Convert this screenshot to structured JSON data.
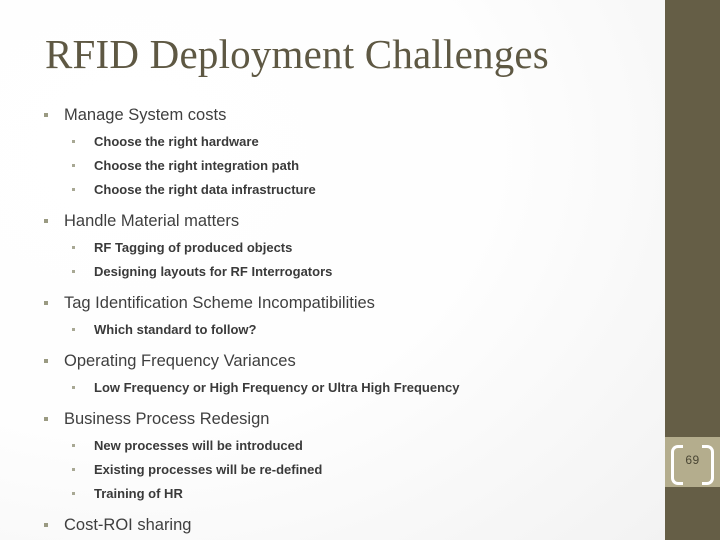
{
  "slide": {
    "title": "RFID Deployment Challenges",
    "page_number": "69",
    "accent_color": "#655E46",
    "title_color": "#5E5843",
    "page_box_color": "#B4AD8D",
    "bullet_color": "#9A9A82",
    "body_text_color": "#3F3F3F"
  },
  "content": [
    {
      "level": 1,
      "text": "Manage System costs"
    },
    {
      "level": 2,
      "text": "Choose the right hardware"
    },
    {
      "level": 2,
      "text": "Choose the right integration path"
    },
    {
      "level": 2,
      "text": "Choose the right data infrastructure"
    },
    {
      "level": 1,
      "text": "Handle Material matters"
    },
    {
      "level": 2,
      "text": "RF Tagging of produced objects"
    },
    {
      "level": 2,
      "text": "Designing layouts for RF Interrogators"
    },
    {
      "level": 1,
      "text": "Tag Identification Scheme Incompatibilities"
    },
    {
      "level": 2,
      "text": "Which standard to follow?"
    },
    {
      "level": 1,
      "text": "Operating Frequency Variances"
    },
    {
      "level": 2,
      "text": "Low Frequency or High Frequency or Ultra High Frequency"
    },
    {
      "level": 1,
      "text": "Business Process Redesign"
    },
    {
      "level": 2,
      "text": "New processes will be introduced"
    },
    {
      "level": 2,
      "text": "Existing processes will be re-defined"
    },
    {
      "level": 2,
      "text": "Training of HR"
    },
    {
      "level": 1,
      "text": "Cost-ROI sharing"
    }
  ]
}
